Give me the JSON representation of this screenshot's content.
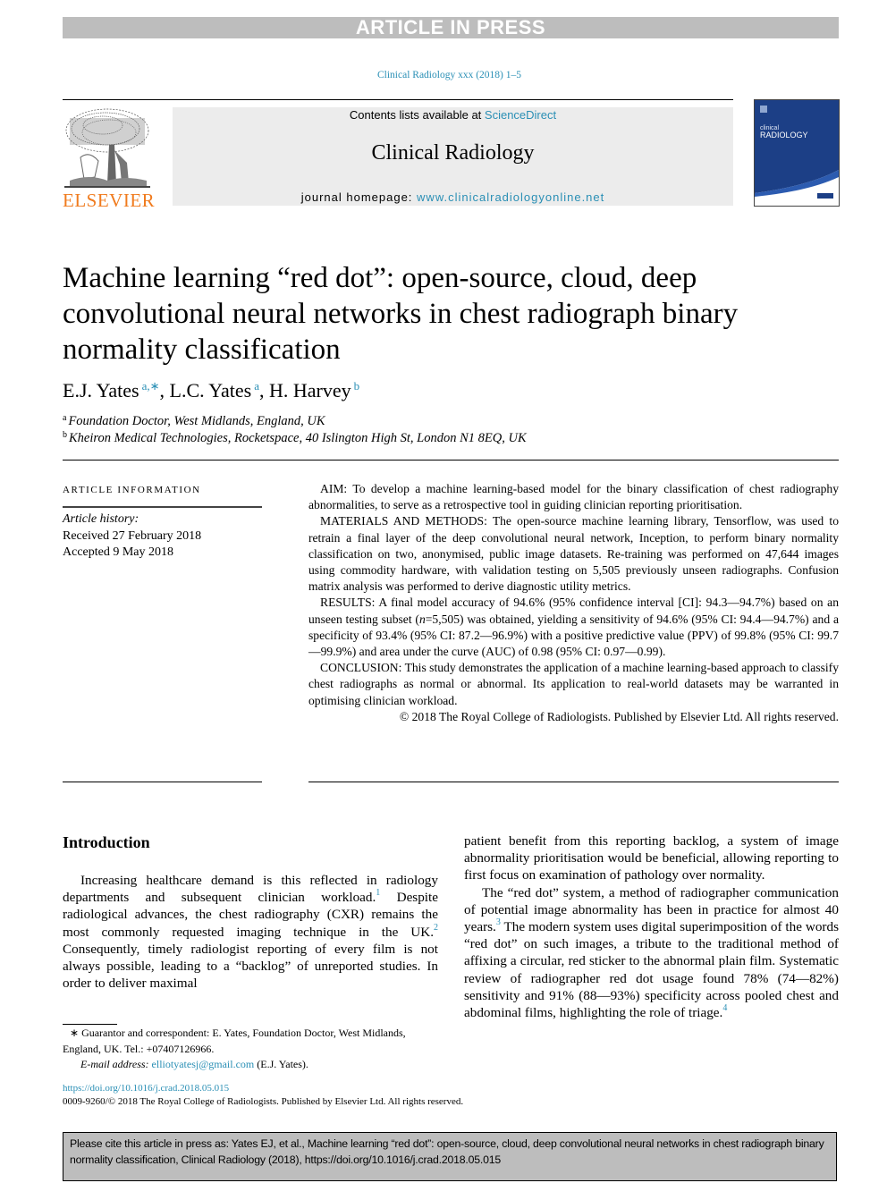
{
  "banner": {
    "label": "ARTICLE IN PRESS"
  },
  "journal_ref": "Clinical Radiology xxx (2018) 1–5",
  "header": {
    "publisher_logo": {
      "icon": "elsevier-tree-icon",
      "wordmark": "ELSEVIER"
    },
    "contents_prefix": "Contents lists available at ",
    "contents_link": "ScienceDirect",
    "journal_name": "Clinical Radiology",
    "homepage_prefix": "journal homepage: ",
    "homepage_link": "www.clinicalradiologyonline.net",
    "cover": {
      "line1": "clinical",
      "line2": "RADIOLOGY",
      "icon": "journal-cover-icon"
    }
  },
  "article": {
    "title": "Machine learning “red dot”: open-source, cloud, deep convolutional neural networks in chest radiograph binary normality classification",
    "authors": [
      {
        "name": "E.J. Yates",
        "affil": "a,∗"
      },
      {
        "name": ", L.C. Yates",
        "affil": "a"
      },
      {
        "name": ", H. Harvey",
        "affil": "b"
      }
    ],
    "affiliations": [
      {
        "mark": "a",
        "text": "Foundation Doctor, West Midlands, England, UK"
      },
      {
        "mark": "b",
        "text": "Kheiron Medical Technologies, Rocketspace, 40 Islington High St, London N1 8EQ, UK"
      }
    ]
  },
  "article_info": {
    "heading": "ARTICLE INFORMATION",
    "history_label": "Article history:",
    "received": "Received 27 February 2018",
    "accepted": "Accepted 9 May 2018"
  },
  "abstract": {
    "aim": "AIM: To develop a machine learning-based model for the binary classification of chest radiography abnormalities, to serve as a retrospective tool in guiding clinician reporting prioritisation.",
    "methods": "MATERIALS AND METHODS: The open-source machine learning library, Tensorflow, was used to retrain a final layer of the deep convolutional neural network, Inception, to perform binary normality classification on two, anonymised, public image datasets. Re-training was performed on 47,644 images using commodity hardware, with validation testing on 5,505 previously unseen radiographs. Confusion matrix analysis was performed to derive diagnostic utility metrics.",
    "results_pre": "RESULTS: A final model accuracy of 94.6% (95% confidence interval [CI]: 94.3—94.7%) based on an unseen testing subset (",
    "results_n": "n",
    "results_post": "=5,505) was obtained, yielding a sensitivity of 94.6% (95% CI: 94.4—94.7%) and a specificity of 93.4% (95% CI: 87.2—96.9%) with a positive predictive value (PPV) of 99.8% (95% CI: 99.7—99.9%) and area under the curve (AUC) of 0.98 (95% CI: 0.97—0.99).",
    "conclusion": "CONCLUSION: This study demonstrates the application of a machine learning-based approach to classify chest radiographs as normal or abnormal. Its application to real-world datasets may be warranted in optimising clinician workload.",
    "copyright": "© 2018 The Royal College of Radiologists. Published by Elsevier Ltd. All rights reserved."
  },
  "introduction": {
    "heading": "Introduction",
    "left_p1_a": "Increasing healthcare demand is this reflected in radiology departments and subsequent clinician workload.",
    "ref1": "1",
    "left_p1_b": " Despite radiological advances, the chest radiography (CXR) remains the most commonly requested imaging technique in the UK.",
    "ref2": "2",
    "left_p1_c": " Consequently, timely radiologist reporting of every film is not always possible, leading to a “backlog” of unreported studies. In order to deliver maximal",
    "right_p1": "patient benefit from this reporting backlog, a system of image abnormality prioritisation would be beneficial, allowing reporting to first focus on examination of pathology over normality.",
    "right_p2_a": "The “red dot” system, a method of radiographer communication of potential image abnormality has been in practice for almost 40 years.",
    "ref3": "3",
    "right_p2_b": " The modern system uses digital superimposition of the words “red dot” on such images, a tribute to the traditional method of affixing a circular, red sticker to the abnormal plain film. Systematic review of radiographer red dot usage found 78% (74—82%) sensitivity and 91% (88—93%) specificity across pooled chest and abdominal films, highlighting the role of triage.",
    "ref4": "4"
  },
  "footnote": {
    "marker": "∗",
    "text": " Guarantor and correspondent: E. Yates, Foundation Doctor, West Midlands, England, UK. Tel.: +07407126966.",
    "email_label": "E-mail address: ",
    "email": "elliotyatesj@gmail.com",
    "email_suffix": " (E.J. Yates)."
  },
  "doi": "https://doi.org/10.1016/j.crad.2018.05.015",
  "issn_line": "0009-9260/© 2018 The Royal College of Radiologists. Published by Elsevier Ltd. All rights reserved.",
  "citation_box": "Please cite this article in press as: Yates EJ, et al., Machine learning “red dot”: open-source, cloud, deep convolutional neural networks in chest radiograph binary normality classification, Clinical Radiology (2018), https://doi.org/10.1016/j.crad.2018.05.015",
  "colors": {
    "link": "#2a8fb5",
    "elsevier_orange": "#f07b1e",
    "banner_gray": "#bdbdbd",
    "journal_box": "#ececec",
    "cover_blue": "#1c3f86"
  }
}
